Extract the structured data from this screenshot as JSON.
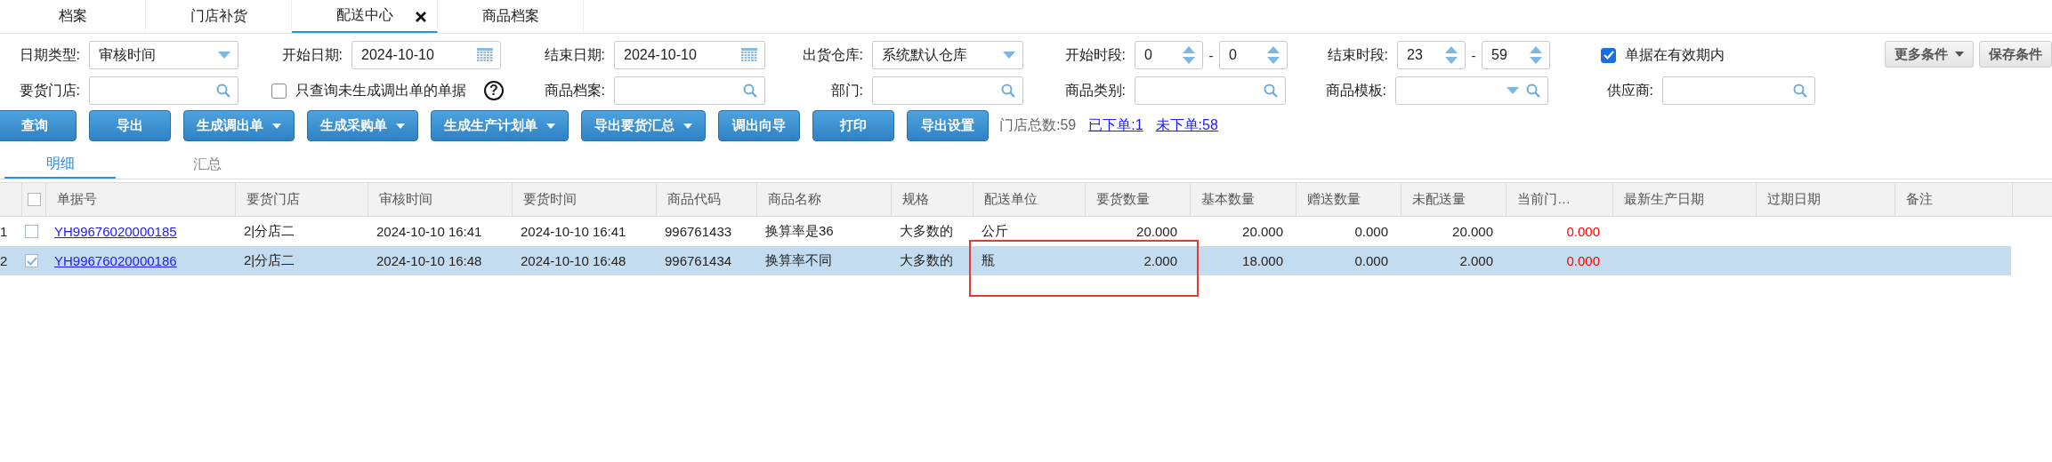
{
  "tabs": [
    {
      "label": "档案",
      "selected": false,
      "closable": false
    },
    {
      "label": "门店补货",
      "selected": false,
      "closable": false
    },
    {
      "label": "配送中心",
      "selected": true,
      "closable": true
    },
    {
      "label": "商品档案",
      "selected": false,
      "closable": false
    }
  ],
  "filters": [
    [
      {
        "kind": "select",
        "label": "日期类型:",
        "value": "审核时间"
      },
      {
        "kind": "date",
        "label": "开始日期:",
        "value": "2024-10-10"
      },
      {
        "kind": "date",
        "label": "结束日期:",
        "value": "2024-10-10"
      },
      {
        "kind": "select",
        "label": "出货仓库:",
        "value": "系统默认仓库"
      },
      {
        "kind": "range",
        "label": "开始时段:",
        "from": "0",
        "to": "0",
        "separator": "-"
      },
      {
        "kind": "range",
        "label": "结束时段:",
        "from": "23",
        "to": "59",
        "separator": "-"
      },
      {
        "kind": "checkbox",
        "label": "单据在有效期内",
        "checked": true
      }
    ],
    [
      {
        "kind": "search",
        "label": "要货门店:"
      },
      {
        "kind": "checkbox",
        "label": "只查询未生成调出单的单据",
        "checked": false,
        "help": "?"
      },
      {
        "kind": "search",
        "label": "商品档案:"
      },
      {
        "kind": "search",
        "label": "部门:"
      },
      {
        "kind": "search",
        "label": "商品类别:"
      },
      {
        "kind": "combo-search",
        "label": "商品模板:"
      },
      {
        "kind": "search",
        "label": "供应商:"
      }
    ]
  ],
  "filter_buttons": [
    {
      "label": "更多条件",
      "kind": "dropdown"
    },
    {
      "label": "保存条件",
      "kind": "plain"
    }
  ],
  "toolbar": [
    {
      "label": "查询",
      "kind": "plain"
    },
    {
      "label": "导出",
      "kind": "plain"
    },
    {
      "label": "生成调出单",
      "kind": "dropdown"
    },
    {
      "label": "生成采购单",
      "kind": "dropdown"
    },
    {
      "label": "生成生产计划单",
      "kind": "dropdown"
    },
    {
      "label": "导出要货汇总",
      "kind": "dropdown"
    },
    {
      "label": "调出向导",
      "kind": "plain"
    },
    {
      "label": "打印",
      "kind": "plain"
    },
    {
      "label": "导出设置",
      "kind": "plain"
    }
  ],
  "summary": {
    "text": "门店总数:59",
    "links": [
      "已下单:1",
      "未下单:58"
    ]
  },
  "subtabs": [
    {
      "label": "明细",
      "selected": true
    },
    {
      "label": "汇总",
      "selected": false
    }
  ],
  "table": {
    "header_checked": false,
    "columns": [
      "单据号",
      "要货门店",
      "审核时间",
      "要货时间",
      "商品代码",
      "商品名称",
      "规格",
      "配送单位",
      "要货数量",
      "基本数量",
      "赠送数量",
      "未配送量",
      "当前门…",
      "最新生产日期",
      "过期日期",
      "备注"
    ],
    "rows": [
      {
        "number": "1",
        "checked": false,
        "selected": false,
        "cells": [
          "YH99676020000185",
          "2|分店二",
          "2024-10-10 16:41",
          "2024-10-10 16:41",
          "996761433",
          "换算率是36",
          "大多数的",
          "公斤",
          "20.000",
          "20.000",
          "0.000",
          "20.000",
          "0.000"
        ]
      },
      {
        "number": "2",
        "checked": true,
        "selected": true,
        "cells": [
          "YH99676020000186",
          "2|分店二",
          "2024-10-10 16:48",
          "2024-10-10 16:48",
          "996761434",
          "换算率不同",
          "大多数的",
          "瓶",
          "2.000",
          "18.000",
          "0.000",
          "2.000",
          "0.000"
        ]
      }
    ]
  }
}
